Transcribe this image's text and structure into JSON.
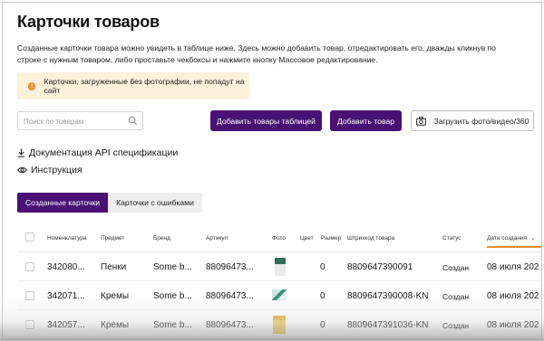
{
  "page": {
    "title": "Карточки товаров",
    "description": "Созданные карточки товара можно увидеть в таблице ниже. Здесь можно добавить товар, отредактировать его, дважды кликнув по строке с нужным товаром, либо проставьте чекбоксы и нажмите кнопку Массовое редактирование."
  },
  "alert": {
    "icon": "warning-icon",
    "text": "Карточки, загруженные без фотографии, не попадут на сайт",
    "color": "#fdf1d9"
  },
  "search": {
    "placeholder": "Поиск по товарам",
    "value": ""
  },
  "buttons": {
    "add_table": "Добавить товары таблицей",
    "add_product": "Добавить товар",
    "upload_media": "Загрузить фото/видео/360"
  },
  "links": {
    "api_docs": "Документация API спецификации",
    "instructions": "Инструкция"
  },
  "tabs": [
    {
      "label": "Созданные карточки",
      "active": true
    },
    {
      "label": "Карточки с ошибками",
      "active": false
    }
  ],
  "table": {
    "columns": [
      "Номенклатура",
      "Предмет",
      "Бренд",
      "Артикул",
      "Фото",
      "Цвет",
      "Размер",
      "Штрихкод товара",
      "Статус",
      "Дата создания"
    ],
    "sorted_column": "Дата создания",
    "rows": [
      {
        "nomenclature": "342080...",
        "subject": "Пенки",
        "brand": "Some b...",
        "article": "88096473...",
        "color": "",
        "size": "0",
        "barcode": "8809647390091",
        "status": "Создан",
        "date": "08 июля 202"
      },
      {
        "nomenclature": "342071...",
        "subject": "Кремы",
        "brand": "Some b...",
        "article": "88096473...",
        "color": "",
        "size": "0",
        "barcode": "8809647390008-KN",
        "status": "Создан",
        "date": "08 июля 202"
      },
      {
        "nomenclature": "342057...",
        "subject": "Кремы",
        "brand": "Some b...",
        "article": "88096473...",
        "color": "",
        "size": "0",
        "barcode": "8809647391036-KN",
        "status": "Создан",
        "date": "08 июля 202"
      }
    ]
  },
  "colors": {
    "primary": "#481173",
    "accent": "#f28a2b"
  }
}
